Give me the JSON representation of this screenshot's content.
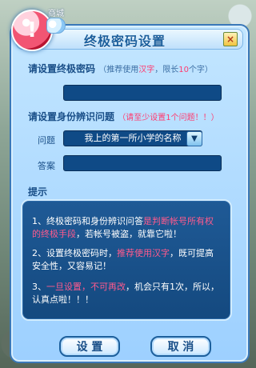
{
  "background": {
    "top_label": "商城"
  },
  "dialog": {
    "title": "终极密码设置",
    "close_glyph": "×"
  },
  "password_section": {
    "label": "请设置终极密码",
    "hint_prefix": "（推荐使用",
    "hint_pink": "汉字",
    "hint_middle": "，限长",
    "hint_limit": "10",
    "hint_suffix": "个字）"
  },
  "identity_section": {
    "label": "请设置身份辨识问题",
    "hint": "（请至少设置1个问题！！）",
    "question_label": "问题",
    "question_value": "我上的第一所小学的名称",
    "answer_label": "答案"
  },
  "tips": {
    "title": "提示",
    "items": [
      {
        "prefix": "1、终极密码和身份辨识问答",
        "highlight": "是判断帐号所有权的终极手段",
        "suffix": "，若帐号被盗，就靠它啦！"
      },
      {
        "prefix": "2、设置终极密码时，",
        "highlight": "推荐使用汉字",
        "suffix": "，既可提高安全性，又容易记！"
      },
      {
        "prefix": "3、",
        "highlight": "一旦设置，不可再改",
        "suffix": "，机会只有1次，所以，认真点啦！！！"
      }
    ]
  },
  "buttons": {
    "set_label": "设 置",
    "cancel_label": "取 消"
  },
  "colors": {
    "dialog_bg_top": "#c3e6ff",
    "dialog_bg_bottom": "#9dd0ff",
    "dialog_border": "#3a78b8",
    "title_text": "#1c5f9c",
    "input_bg": "#0f4a86",
    "tips_bg": "#1f5a96",
    "highlight_pink": "#ff3a6f"
  },
  "icons": {
    "alert": "exclamation-badge-icon",
    "close": "close-icon",
    "dropdown": "chevron-down-icon"
  }
}
